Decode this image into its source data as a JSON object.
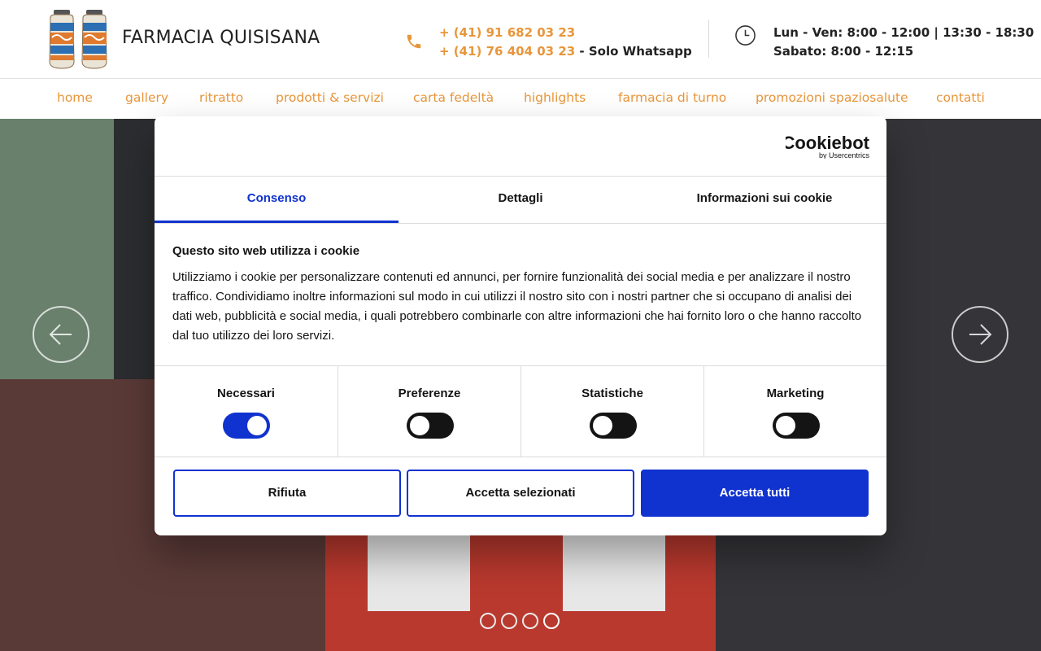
{
  "header": {
    "brand": "FARMACIA QUISISANA",
    "phone_1": "+ (41) 91 682 03 23",
    "phone_2": "+ (41) 76 404 03 23",
    "phone_2_note": " - Solo Whatsapp",
    "hours_1": "Lun - Ven: 8:00 - 12:00 | 13:30 - 18:30",
    "hours_2": "Sabato: 8:00 - 12:15",
    "accent_color": "#e8963b",
    "phone_icon": "phone-icon",
    "clock_icon": "clock-icon"
  },
  "nav": {
    "items": [
      {
        "label": "home"
      },
      {
        "label": "gallery"
      },
      {
        "label": "ritratto"
      },
      {
        "label": "prodotti & servizi"
      },
      {
        "label": "carta fedeltà"
      },
      {
        "label": "highlights"
      },
      {
        "label": "farmacia di turno"
      },
      {
        "label": "promozioni spaziosalute"
      },
      {
        "label": "contatti"
      }
    ]
  },
  "slider": {
    "dots_total": 4,
    "active_dot": 4,
    "prev_icon": "arrow-left-icon",
    "next_icon": "arrow-right-icon"
  },
  "cookie_dialog": {
    "logo_text": "Cookiebot",
    "logo_subtext": "by Usercentrics",
    "tabs": [
      {
        "label": "Consenso",
        "active": true
      },
      {
        "label": "Dettagli",
        "active": false
      },
      {
        "label": "Informazioni sui cookie",
        "active": false
      }
    ],
    "title": "Questo sito web utilizza i cookie",
    "body": "Utilizziamo i cookie per personalizzare contenuti ed annunci, per fornire funzionalità dei social media e per analizzare il nostro traffico. Condividiamo inoltre informazioni sul modo in cui utilizzi il nostro sito con i nostri partner che si occupano di analisi dei dati web, pubblicità e social media, i quali potrebbero combinarle con altre informazioni che hai fornito loro o che hanno raccolto dal tuo utilizzo dei loro servizi.",
    "categories": [
      {
        "label": "Necessari",
        "enabled": true
      },
      {
        "label": "Preferenze",
        "enabled": false
      },
      {
        "label": "Statistiche",
        "enabled": false
      },
      {
        "label": "Marketing",
        "enabled": false
      }
    ],
    "buttons": {
      "deny": "Rifiuta",
      "allow_selected": "Accetta selezionati",
      "allow_all": "Accetta tutti"
    },
    "accent_color": "#1032cf"
  }
}
